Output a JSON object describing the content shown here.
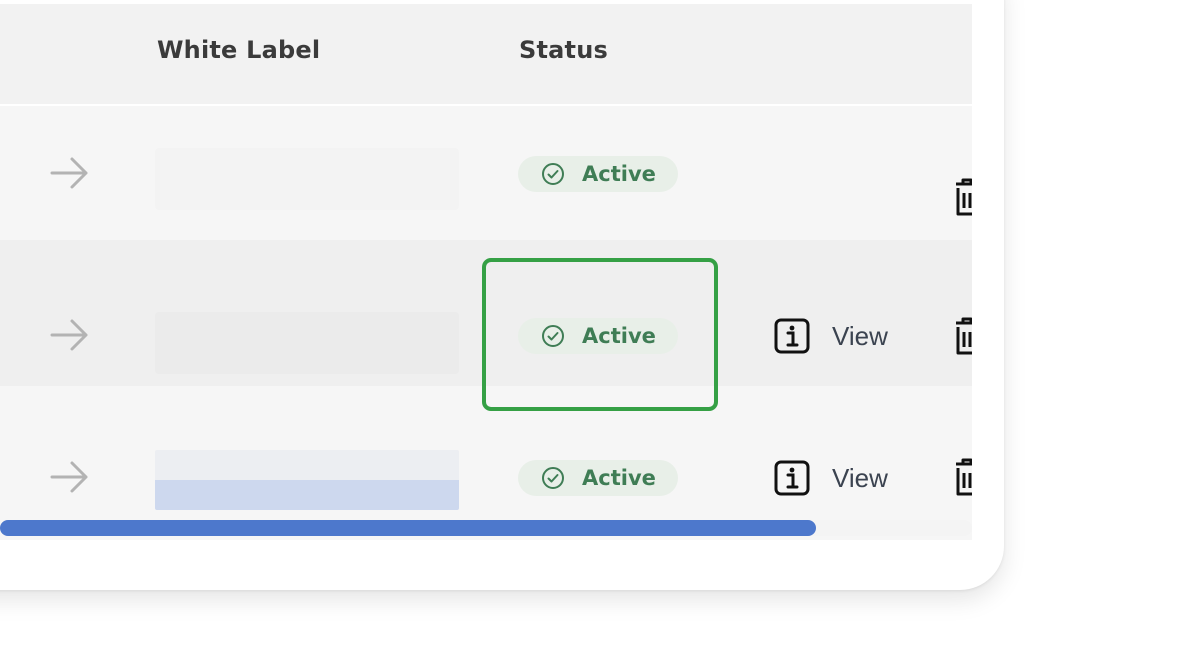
{
  "table": {
    "columns": {
      "white_label": "White Label",
      "status": "Status"
    },
    "rows": [
      {
        "status": "Active",
        "has_view": false
      },
      {
        "status": "Active",
        "has_view": true,
        "view_label": "View"
      },
      {
        "status": "Active",
        "has_view": true,
        "view_label": "View"
      }
    ]
  },
  "scrollbar": {
    "position_fraction": 0.84
  },
  "colors": {
    "accent": "#4d78cc",
    "status_active_text": "#3f7d55",
    "status_active_bg": "#e8efe8",
    "highlight": "#35a045"
  },
  "icons": [
    "arrow-right-icon",
    "check-circle-icon",
    "info-icon",
    "trash-icon"
  ]
}
